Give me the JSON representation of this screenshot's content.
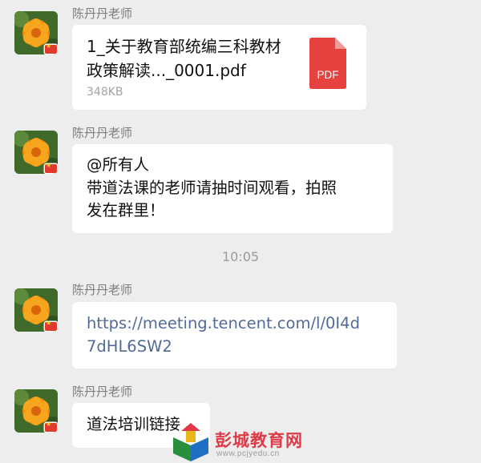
{
  "messages": [
    {
      "sender": "陈丹丹老师",
      "type": "file",
      "file_title": "1_关于教育部统编三科教材政策解读..._0001.pdf",
      "file_size": "348KB",
      "file_type_label": "PDF"
    },
    {
      "sender": "陈丹丹老师",
      "type": "text",
      "lines": [
        "@所有人",
        "带道法课的老师请抽时间观看，拍照",
        "发在群里！"
      ]
    },
    {
      "sender": "陈丹丹老师",
      "type": "link",
      "lines": [
        "https://meeting.tencent.com/l/0I4d",
        "7dHL6SW2"
      ]
    },
    {
      "sender": "陈丹丹老师",
      "type": "text",
      "lines": [
        "道法培训链接"
      ]
    }
  ],
  "timestamp": "10:05",
  "watermark": {
    "name": "彭城教育网",
    "url": "www.pcjyedu.cn"
  },
  "colors": {
    "background": "#ededed",
    "bubble": "#ffffff",
    "link": "#516b96",
    "pdf_icon": "#e64340",
    "watermark": "#e03a48"
  }
}
